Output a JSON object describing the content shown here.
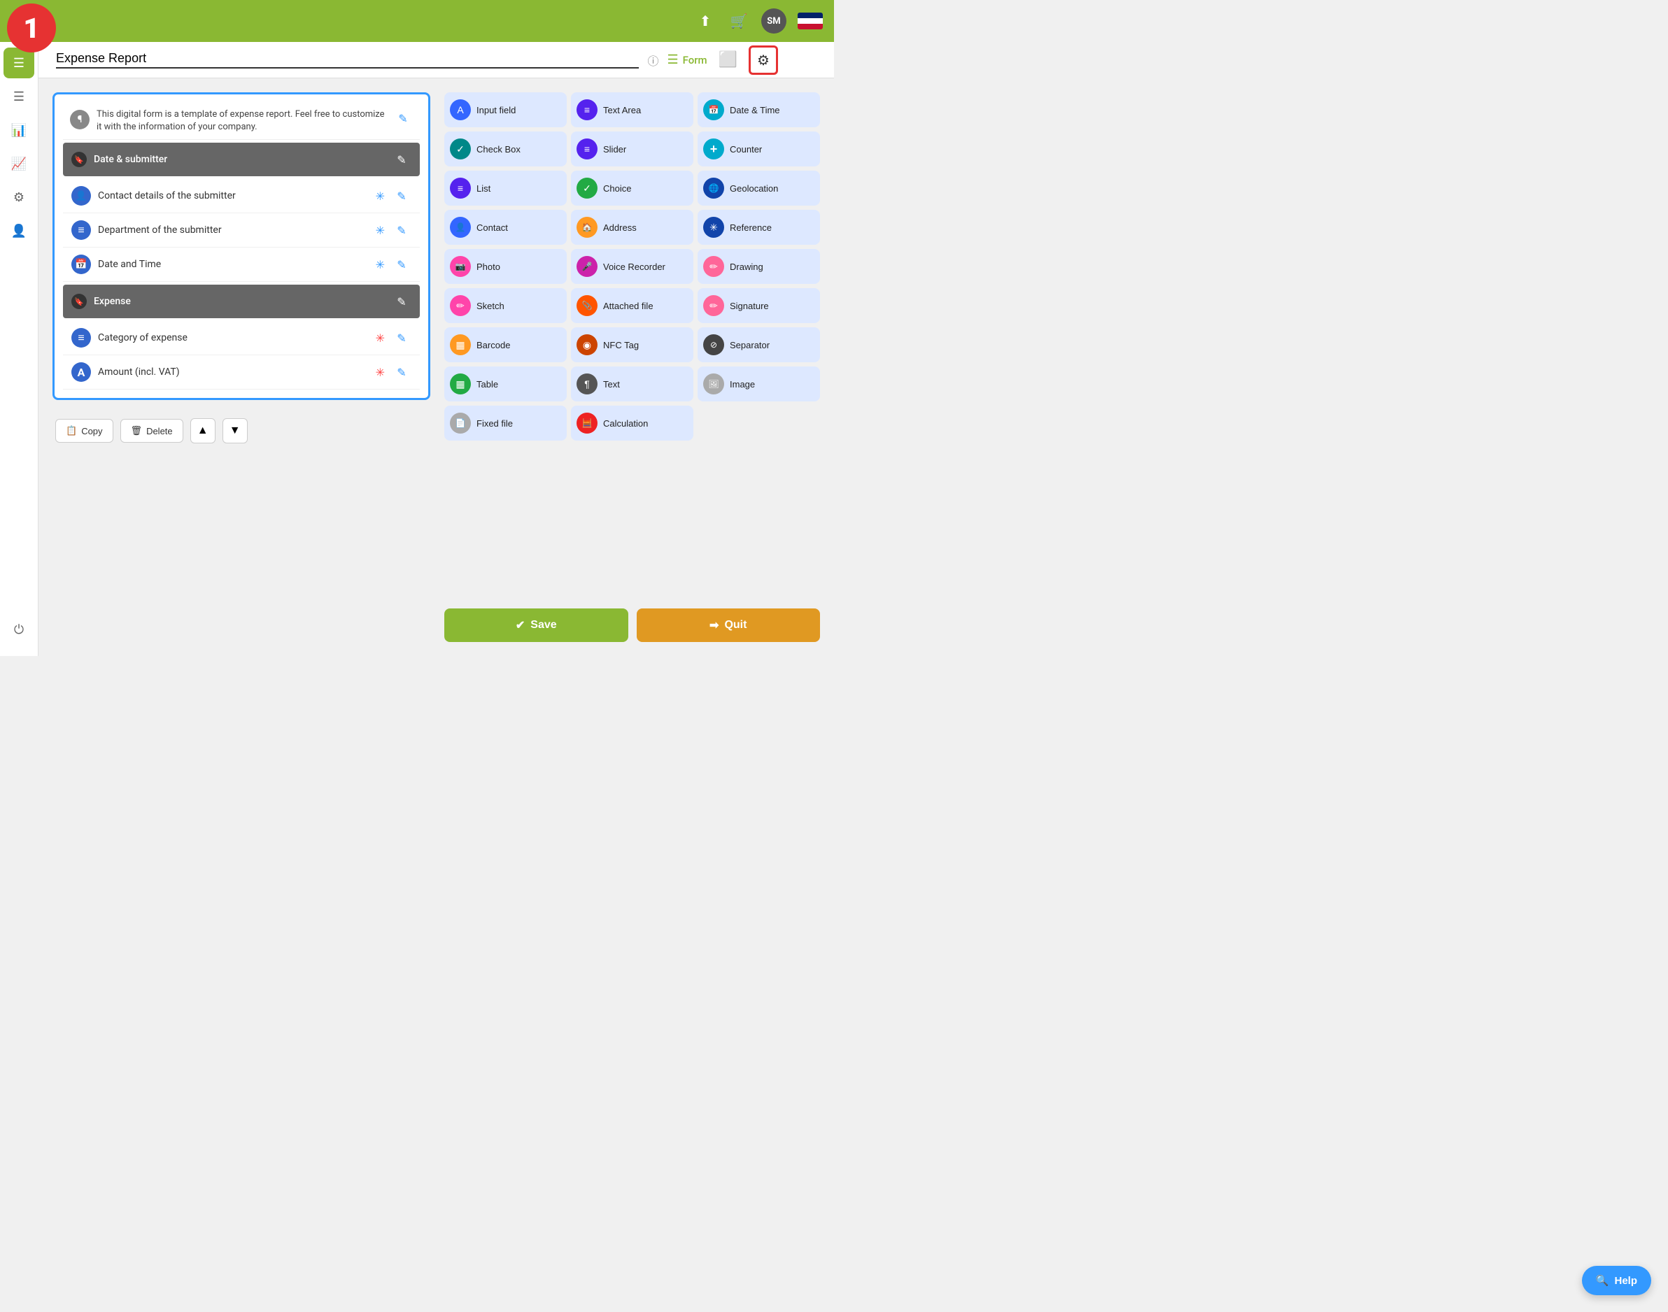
{
  "header": {
    "logo_number": "1",
    "avatar_text": "SM",
    "upload_icon": "⬆",
    "basket_icon": "🛒"
  },
  "toolbar": {
    "form_title": "Expense Report",
    "info_icon": "ⓘ",
    "form_label": "Form",
    "save_label": "Save",
    "quit_label": "Quit"
  },
  "sidebar": {
    "items": [
      {
        "label": "menu-icon",
        "icon": "☰",
        "active": true
      },
      {
        "label": "list-icon",
        "icon": "☰"
      },
      {
        "label": "chart-icon",
        "icon": "📊"
      },
      {
        "label": "stats-icon",
        "icon": "📈"
      },
      {
        "label": "settings-icon",
        "icon": "⚙"
      },
      {
        "label": "user-icon",
        "icon": "👤"
      },
      {
        "label": "power-icon",
        "icon": "⏻"
      }
    ]
  },
  "form": {
    "description": "This digital form is a template of expense report. Feel free to customize it with the information of your company.",
    "sections": [
      {
        "type": "section-header",
        "label": "Date & submitter"
      },
      {
        "type": "field",
        "label": "Contact details of the submitter",
        "icon_color": "blue",
        "icon": "👤",
        "required": true,
        "required_color": "blue"
      },
      {
        "type": "field",
        "label": "Department of the submitter",
        "icon_color": "blue",
        "icon": "≡",
        "required": true,
        "required_color": "blue"
      },
      {
        "type": "field",
        "label": "Date and Time",
        "icon_color": "blue",
        "icon": "📅",
        "required": true,
        "required_color": "blue"
      },
      {
        "type": "section-header",
        "label": "Expense"
      },
      {
        "type": "field",
        "label": "Category of expense",
        "icon_color": "blue",
        "icon": "≡",
        "required": true,
        "required_color": "red"
      },
      {
        "type": "field",
        "label": "Amount (incl. VAT)",
        "icon_color": "blue",
        "icon": "A",
        "required": true,
        "required_color": "red"
      }
    ]
  },
  "actions": {
    "copy": "Copy",
    "delete": "Delete",
    "up": "▲",
    "down": "▼"
  },
  "field_types": [
    {
      "label": "Input field",
      "icon": "A",
      "color": "ft-blue"
    },
    {
      "label": "Text Area",
      "icon": "≡",
      "color": "ft-indigo"
    },
    {
      "label": "Date & Time",
      "icon": "📅",
      "color": "ft-cyan"
    },
    {
      "label": "Check Box",
      "icon": "✓",
      "color": "ft-teal"
    },
    {
      "label": "Slider",
      "icon": "≡",
      "color": "ft-indigo"
    },
    {
      "label": "Counter",
      "icon": "+",
      "color": "ft-cyan"
    },
    {
      "label": "List",
      "icon": "≡",
      "color": "ft-indigo"
    },
    {
      "label": "Choice",
      "icon": "✓",
      "color": "ft-green"
    },
    {
      "label": "Geolocation",
      "icon": "🌐",
      "color": "ft-darkblue"
    },
    {
      "label": "Contact",
      "icon": "👤",
      "color": "ft-blue"
    },
    {
      "label": "Address",
      "icon": "🏠",
      "color": "ft-orange"
    },
    {
      "label": "Reference",
      "icon": "✳",
      "color": "ft-darkblue"
    },
    {
      "label": "Photo",
      "icon": "📷",
      "color": "ft-pink"
    },
    {
      "label": "Voice Recorder",
      "icon": "🎤",
      "color": "ft-magenta"
    },
    {
      "label": "Drawing",
      "icon": "✏",
      "color": "ft-lightpink"
    },
    {
      "label": "Sketch",
      "icon": "✏",
      "color": "ft-pink"
    },
    {
      "label": "Attached file",
      "icon": "📎",
      "color": "ft-orangered"
    },
    {
      "label": "Signature",
      "icon": "✏",
      "color": "ft-lightpink"
    },
    {
      "label": "Barcode",
      "icon": "▦",
      "color": "ft-orange"
    },
    {
      "label": "NFC Tag",
      "icon": "◉",
      "color": "ft-darkorange"
    },
    {
      "label": "Separator",
      "icon": "⊘",
      "color": "ft-darkgray"
    },
    {
      "label": "Table",
      "icon": "▦",
      "color": "ft-green"
    },
    {
      "label": "Text",
      "icon": "¶",
      "color": "ft-gray"
    },
    {
      "label": "Image",
      "icon": "🖼",
      "color": "ft-lightgray"
    },
    {
      "label": "Fixed file",
      "icon": "📄",
      "color": "ft-lightgray"
    },
    {
      "label": "Calculation",
      "icon": "🧮",
      "color": "ft-red"
    }
  ],
  "bottom_buttons": {
    "save": "✔ Save",
    "quit": "➡ Quit"
  },
  "help": "Help"
}
